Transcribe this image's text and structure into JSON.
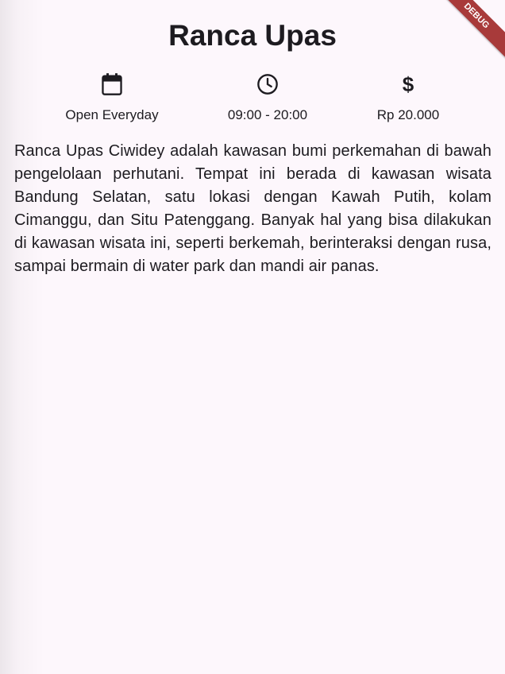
{
  "app": {
    "title": "Ranca Upas",
    "debug_label": "DEBUG"
  },
  "info": [
    {
      "icon": "calendar-icon",
      "label": "Open Everyday"
    },
    {
      "icon": "clock-icon",
      "label": "09:00 - 20:00"
    },
    {
      "icon": "dollar-icon",
      "label": "Rp 20.000"
    }
  ],
  "description": "Ranca Upas Ciwidey adalah kawasan bumi perkemahan di bawah pengelolaan perhutani. Tempat ini berada di kawasan wisata Bandung Selatan, satu lokasi dengan Kawah Putih, kolam Cimanggu, dan Situ Patenggang. Banyak hal yang bisa dilakukan di kawasan wisata ini, seperti berkemah, berinteraksi dengan rusa, sampai bermain di water park dan mandi air panas.",
  "colors": {
    "background": "#fdf7fc",
    "text": "#1d1b20",
    "debug_banner": "#a83a3a"
  }
}
